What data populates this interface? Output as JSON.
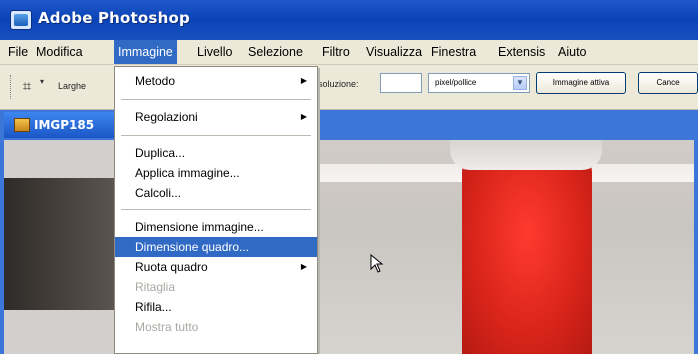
{
  "app": {
    "title": "Adobe Photoshop",
    "colors": {
      "titlebar": "#0a44b6",
      "highlight": "#316ac5",
      "menu_bg": "#ece9d8",
      "red_object": "#e02a20"
    }
  },
  "menubar": {
    "items": [
      "File",
      "Modifica",
      "Immagine",
      "Livello",
      "Selezione",
      "Filtro",
      "Visualizza",
      "Finestra",
      "Extensis",
      "Aiuto"
    ],
    "active": "Immagine"
  },
  "options_bar": {
    "tool_icon": "crop-icon",
    "width_label": "Larghe",
    "resolution_label": "soluzione:",
    "resolution_value": "",
    "unit_value": "pixel/pollice",
    "front_image_button": "Immagine attiva",
    "clear_button": "Cance"
  },
  "document": {
    "title": "IMGP185",
    "icon": "image-document-icon"
  },
  "dropdown": {
    "items": [
      {
        "label": "Metodo",
        "submenu": true,
        "state": "normal"
      },
      {
        "label": "Regolazioni",
        "submenu": true,
        "state": "normal"
      },
      {
        "label": "Duplica...",
        "submenu": false,
        "state": "normal"
      },
      {
        "label": "Applica immagine...",
        "submenu": false,
        "state": "normal"
      },
      {
        "label": "Calcoli...",
        "submenu": false,
        "state": "normal"
      },
      {
        "label": "Dimensione immagine...",
        "submenu": false,
        "state": "normal"
      },
      {
        "label": "Dimensione quadro...",
        "submenu": false,
        "state": "highlighted"
      },
      {
        "label": "Ruota quadro",
        "submenu": true,
        "state": "normal"
      },
      {
        "label": "Ritaglia",
        "submenu": false,
        "state": "disabled"
      },
      {
        "label": "Rifila...",
        "submenu": false,
        "state": "normal"
      },
      {
        "label": "Mostra tutto",
        "submenu": false,
        "state": "disabled"
      }
    ]
  },
  "cursor": {
    "icon": "mouse-pointer-icon"
  }
}
